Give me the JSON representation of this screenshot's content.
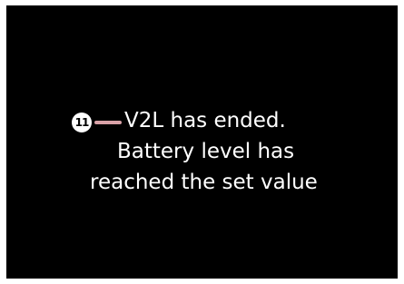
{
  "callout": {
    "number": "11"
  },
  "message": {
    "line1": "V2L has ended.",
    "line2": "Battery level has",
    "line3": "reached the set value"
  },
  "colors": {
    "screen_background": "#000000",
    "text": "#ffffff",
    "leader_line": "#d9a2a7",
    "callout_badge": "#ffffff"
  }
}
